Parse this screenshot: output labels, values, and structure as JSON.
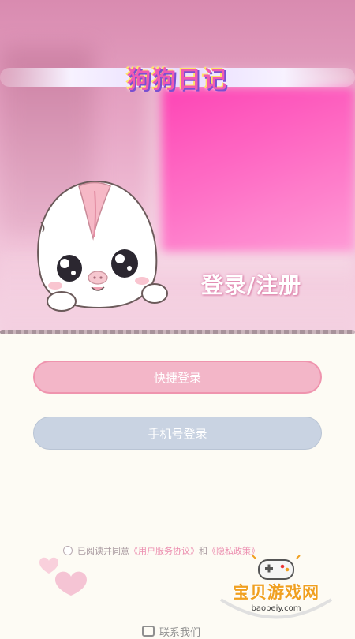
{
  "hero": {
    "logo_text": "狗狗日记",
    "title": "登录/注册"
  },
  "buttons": {
    "quick_login": "快捷登录",
    "phone_login": "手机号登录"
  },
  "agreement": {
    "prefix": "已阅读并同意",
    "user_agreement": "《用户服务协议》",
    "and": "和",
    "privacy_policy": "《隐私政策》"
  },
  "watermark": {
    "name": "宝贝游戏网",
    "url": "baobeiy.com"
  },
  "footer": {
    "contact": "联系我们"
  },
  "colors": {
    "primary_button": "#f3b6c8",
    "secondary_button": "#c9d3e2",
    "link": "#ec8fb0",
    "background": "#fdfbf4"
  }
}
